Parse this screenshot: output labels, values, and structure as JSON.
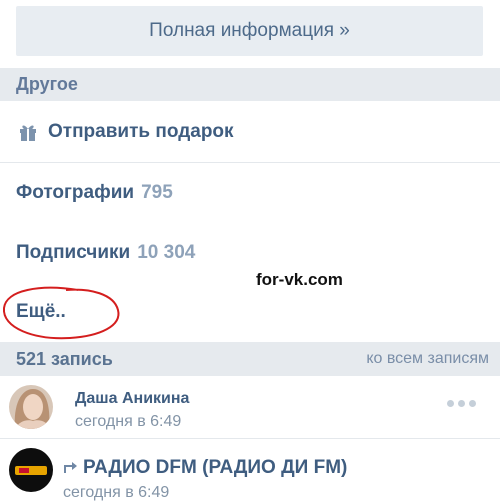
{
  "full_info": {
    "label": "Полная информация »"
  },
  "other_section": {
    "title": "Другое"
  },
  "menu": {
    "gift": {
      "label": "Отправить подарок"
    },
    "photos": {
      "label": "Фотографии",
      "count": "795"
    },
    "subscribers": {
      "label": "Подписчики",
      "count": "10 304"
    },
    "more": {
      "label": "Ещё.."
    }
  },
  "watermark": "for-vk.com",
  "wall": {
    "count_label": "521 запись",
    "all_posts_link": "ко всем записям"
  },
  "posts": [
    {
      "author": "Даша Аникина",
      "time": "сегодня в 6:49"
    },
    {
      "author": "РАДИО DFM (РАДИО ДИ FM)",
      "time": "сегодня в 6:49"
    }
  ],
  "colors": {
    "link": "#3f5d80",
    "muted": "#8ea2b9",
    "header_bg": "#e6eaee",
    "annotation": "#d41e1e"
  }
}
